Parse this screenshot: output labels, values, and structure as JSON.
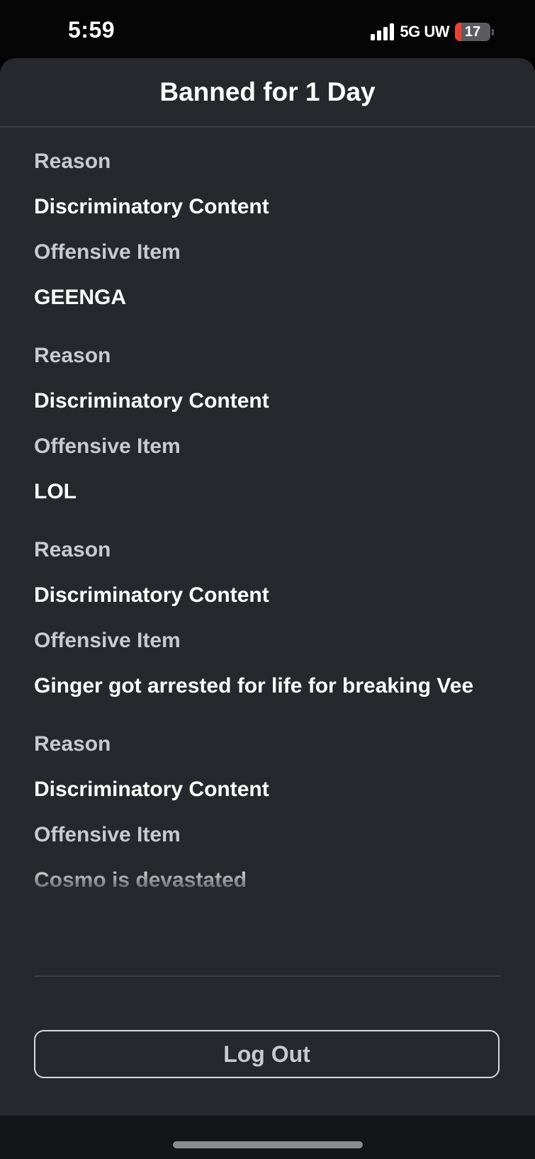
{
  "status_bar": {
    "time": "5:59",
    "network": "5G UW",
    "battery_level": "17",
    "battery_fraction": 0.17,
    "battery_color": "#eb4133",
    "signal_bars": 4
  },
  "modal": {
    "title": "Banned for 1 Day",
    "entries": [
      {
        "reason_label": "Reason",
        "reason": "Discriminatory Content",
        "item_label": "Offensive Item",
        "item": "GEENGA"
      },
      {
        "reason_label": "Reason",
        "reason": "Discriminatory Content",
        "item_label": "Offensive Item",
        "item": "LOL"
      },
      {
        "reason_label": "Reason",
        "reason": "Discriminatory Content",
        "item_label": "Offensive Item",
        "item": "Ginger got arrested for life for breaking Vee"
      },
      {
        "reason_label": "Reason",
        "reason": "Discriminatory Content",
        "item_label": "Offensive Item",
        "item": "Cosmo is devastated"
      }
    ],
    "logout_label": "Log Out"
  },
  "colors": {
    "sheet_background": "#27282d",
    "label_text": "#c9cad0",
    "value_text": "#ffffff",
    "divider": "#3e3f45"
  },
  "icons": {
    "signal": "signal-bars-icon",
    "battery": "battery-icon",
    "home": "home-indicator"
  }
}
